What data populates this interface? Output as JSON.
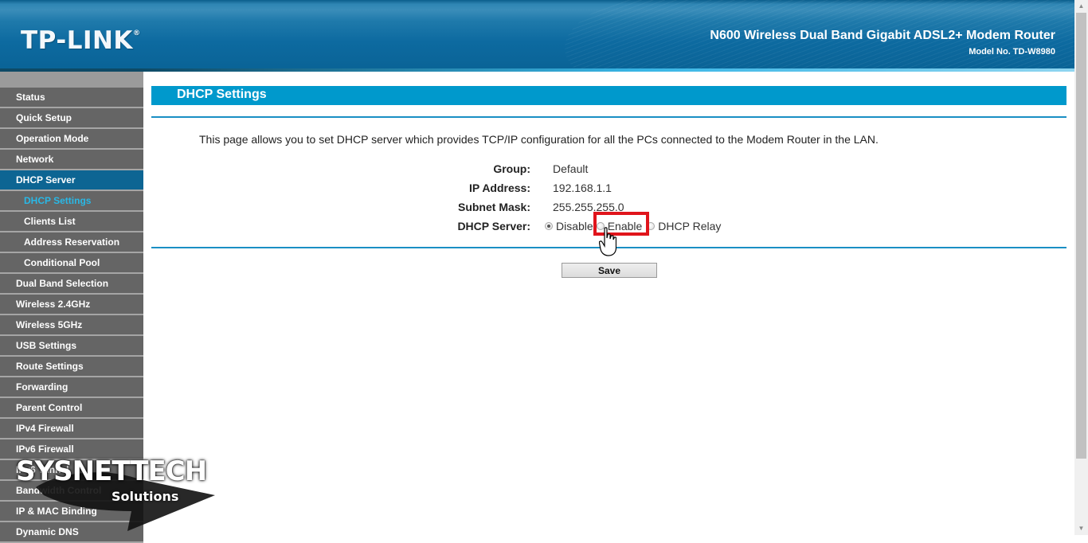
{
  "header": {
    "logo": "TP-LINK",
    "logo_mark": "®",
    "product_title": "N600 Wireless Dual Band Gigabit ADSL2+ Modem Router",
    "model_no": "Model No. TD-W8980"
  },
  "sidebar": {
    "items": [
      {
        "label": "Status"
      },
      {
        "label": "Quick Setup"
      },
      {
        "label": "Operation Mode"
      },
      {
        "label": "Network"
      },
      {
        "label": "DHCP Server"
      },
      {
        "label": "DHCP Settings"
      },
      {
        "label": "Clients List"
      },
      {
        "label": "Address Reservation"
      },
      {
        "label": "Conditional Pool"
      },
      {
        "label": "Dual Band Selection"
      },
      {
        "label": "Wireless 2.4GHz"
      },
      {
        "label": "Wireless 5GHz"
      },
      {
        "label": "USB Settings"
      },
      {
        "label": "Route Settings"
      },
      {
        "label": "Forwarding"
      },
      {
        "label": "Parent Control"
      },
      {
        "label": "IPv4 Firewall"
      },
      {
        "label": "IPv6 Firewall"
      },
      {
        "label": "IPv6 Tunnel"
      },
      {
        "label": "Bandwidth Control"
      },
      {
        "label": "IP & MAC Binding"
      },
      {
        "label": "Dynamic DNS"
      }
    ]
  },
  "main": {
    "title": "DHCP Settings",
    "intro": "This page allows you to set DHCP server which provides TCP/IP configuration for all the PCs connected to the Modem Router in the LAN.",
    "fields": {
      "group": {
        "label": "Group:",
        "value": "Default"
      },
      "ip_address": {
        "label": "IP Address:",
        "value": "192.168.1.1"
      },
      "subnet_mask": {
        "label": "Subnet Mask:",
        "value": "255.255.255.0"
      },
      "dhcp_server": {
        "label": "DHCP Server:",
        "options": [
          "Disable",
          "Enable",
          "DHCP Relay"
        ],
        "selected": "Disable"
      }
    },
    "save_label": "Save"
  },
  "watermark": {
    "title": "SYSNETTECH",
    "subtitle": "Solutions"
  },
  "colors": {
    "accent": "#0099cc",
    "active_menu": "#0d6593",
    "current_submenu_text": "#29b8e6",
    "highlight": "#e0141b"
  }
}
